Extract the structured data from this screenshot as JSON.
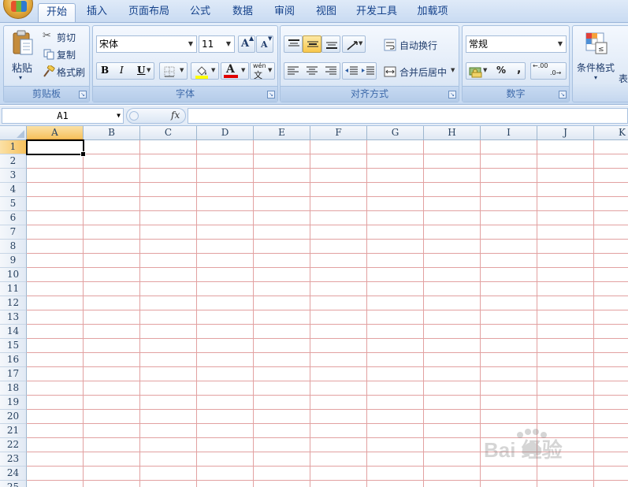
{
  "tabs": [
    {
      "label": "开始",
      "active": true
    },
    {
      "label": "插入"
    },
    {
      "label": "页面布局"
    },
    {
      "label": "公式"
    },
    {
      "label": "数据"
    },
    {
      "label": "审阅"
    },
    {
      "label": "视图"
    },
    {
      "label": "开发工具"
    },
    {
      "label": "加载项"
    }
  ],
  "clipboard": {
    "group_label": "剪贴板",
    "paste": "粘贴",
    "cut": "剪切",
    "copy": "复制",
    "format_painter": "格式刷"
  },
  "font": {
    "group_label": "字体",
    "font_name": "宋体",
    "font_size": "11",
    "grow_glyph": "A",
    "shrink_glyph": "A",
    "bold": "B",
    "italic": "I",
    "underline": "U",
    "font_color_glyph": "A",
    "phonetic_top": "wén",
    "phonetic_bottom": "文"
  },
  "alignment": {
    "group_label": "对齐方式",
    "wrap_text": "自动换行",
    "merge_center": "合并后居中"
  },
  "number": {
    "group_label": "数字",
    "format": "常规",
    "percent": "%",
    "comma": ",",
    "inc_decimal": ".00",
    "dec_decimal": ".0"
  },
  "styles": {
    "conditional_format": "条件格式",
    "table_format_partial": "表"
  },
  "formula_bar": {
    "name_box": "A1",
    "fx": "fx"
  },
  "columns": [
    "A",
    "B",
    "C",
    "D",
    "E",
    "F",
    "G",
    "H",
    "I",
    "J",
    "K"
  ],
  "rows": [
    "1",
    "2",
    "3",
    "4",
    "5",
    "6",
    "7",
    "8",
    "9",
    "10",
    "11",
    "12",
    "13",
    "14",
    "15",
    "16",
    "17",
    "18",
    "19",
    "20",
    "21",
    "22",
    "23",
    "24",
    "25"
  ],
  "watermark": "Bai 经验"
}
